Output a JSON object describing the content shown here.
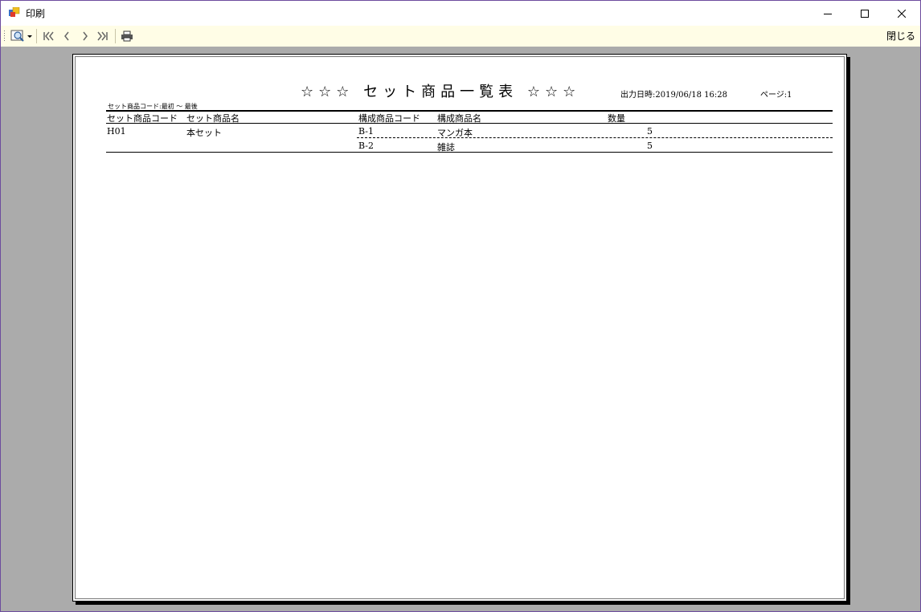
{
  "window": {
    "title": "印刷"
  },
  "toolbar": {
    "icons": [
      "zoom-icon",
      "dropdown-arrow-icon",
      "first-page-icon",
      "prev-page-icon",
      "next-page-icon",
      "last-page-icon",
      "printer-icon"
    ],
    "close_label": "閉じる"
  },
  "report": {
    "title": "☆☆☆ セット商品一覧表 ☆☆☆",
    "output_date": "出力日時:2019/06/18 16:28",
    "page_label": "ページ:1",
    "range": "セット商品コード:最初 ～ 最後",
    "headers": {
      "set_code": "セット商品コード",
      "set_name": "セット商品名",
      "comp_code": "構成商品コード",
      "comp_name": "構成商品名",
      "qty": "数量"
    },
    "rows": [
      {
        "set_code": "H01",
        "set_name": "本セット",
        "comp_code": "B-1",
        "comp_name": "マンガ本",
        "qty": "5"
      },
      {
        "set_code": "",
        "set_name": "",
        "comp_code": "B-2",
        "comp_name": "雑誌",
        "qty": "5"
      }
    ]
  }
}
